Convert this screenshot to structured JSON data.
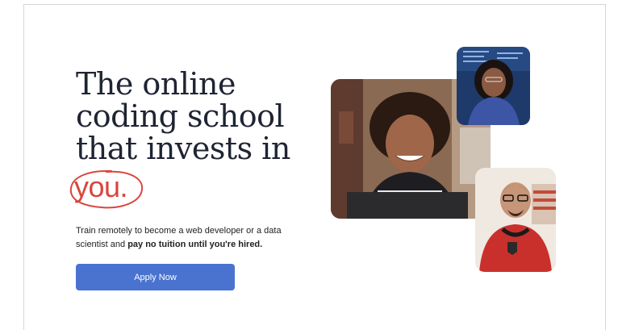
{
  "hero": {
    "headline_lines": [
      "The online",
      "coding school",
      "that invests in"
    ],
    "headline_highlight": "you.",
    "subtitle_plain": "Train remotely to become a web developer or a data scientist and ",
    "subtitle_bold": "pay no tuition until you're hired.",
    "cta_label": "Apply Now"
  },
  "colors": {
    "accent": "#4a73cf",
    "highlight": "#d9463d",
    "heading": "#1f2433"
  }
}
